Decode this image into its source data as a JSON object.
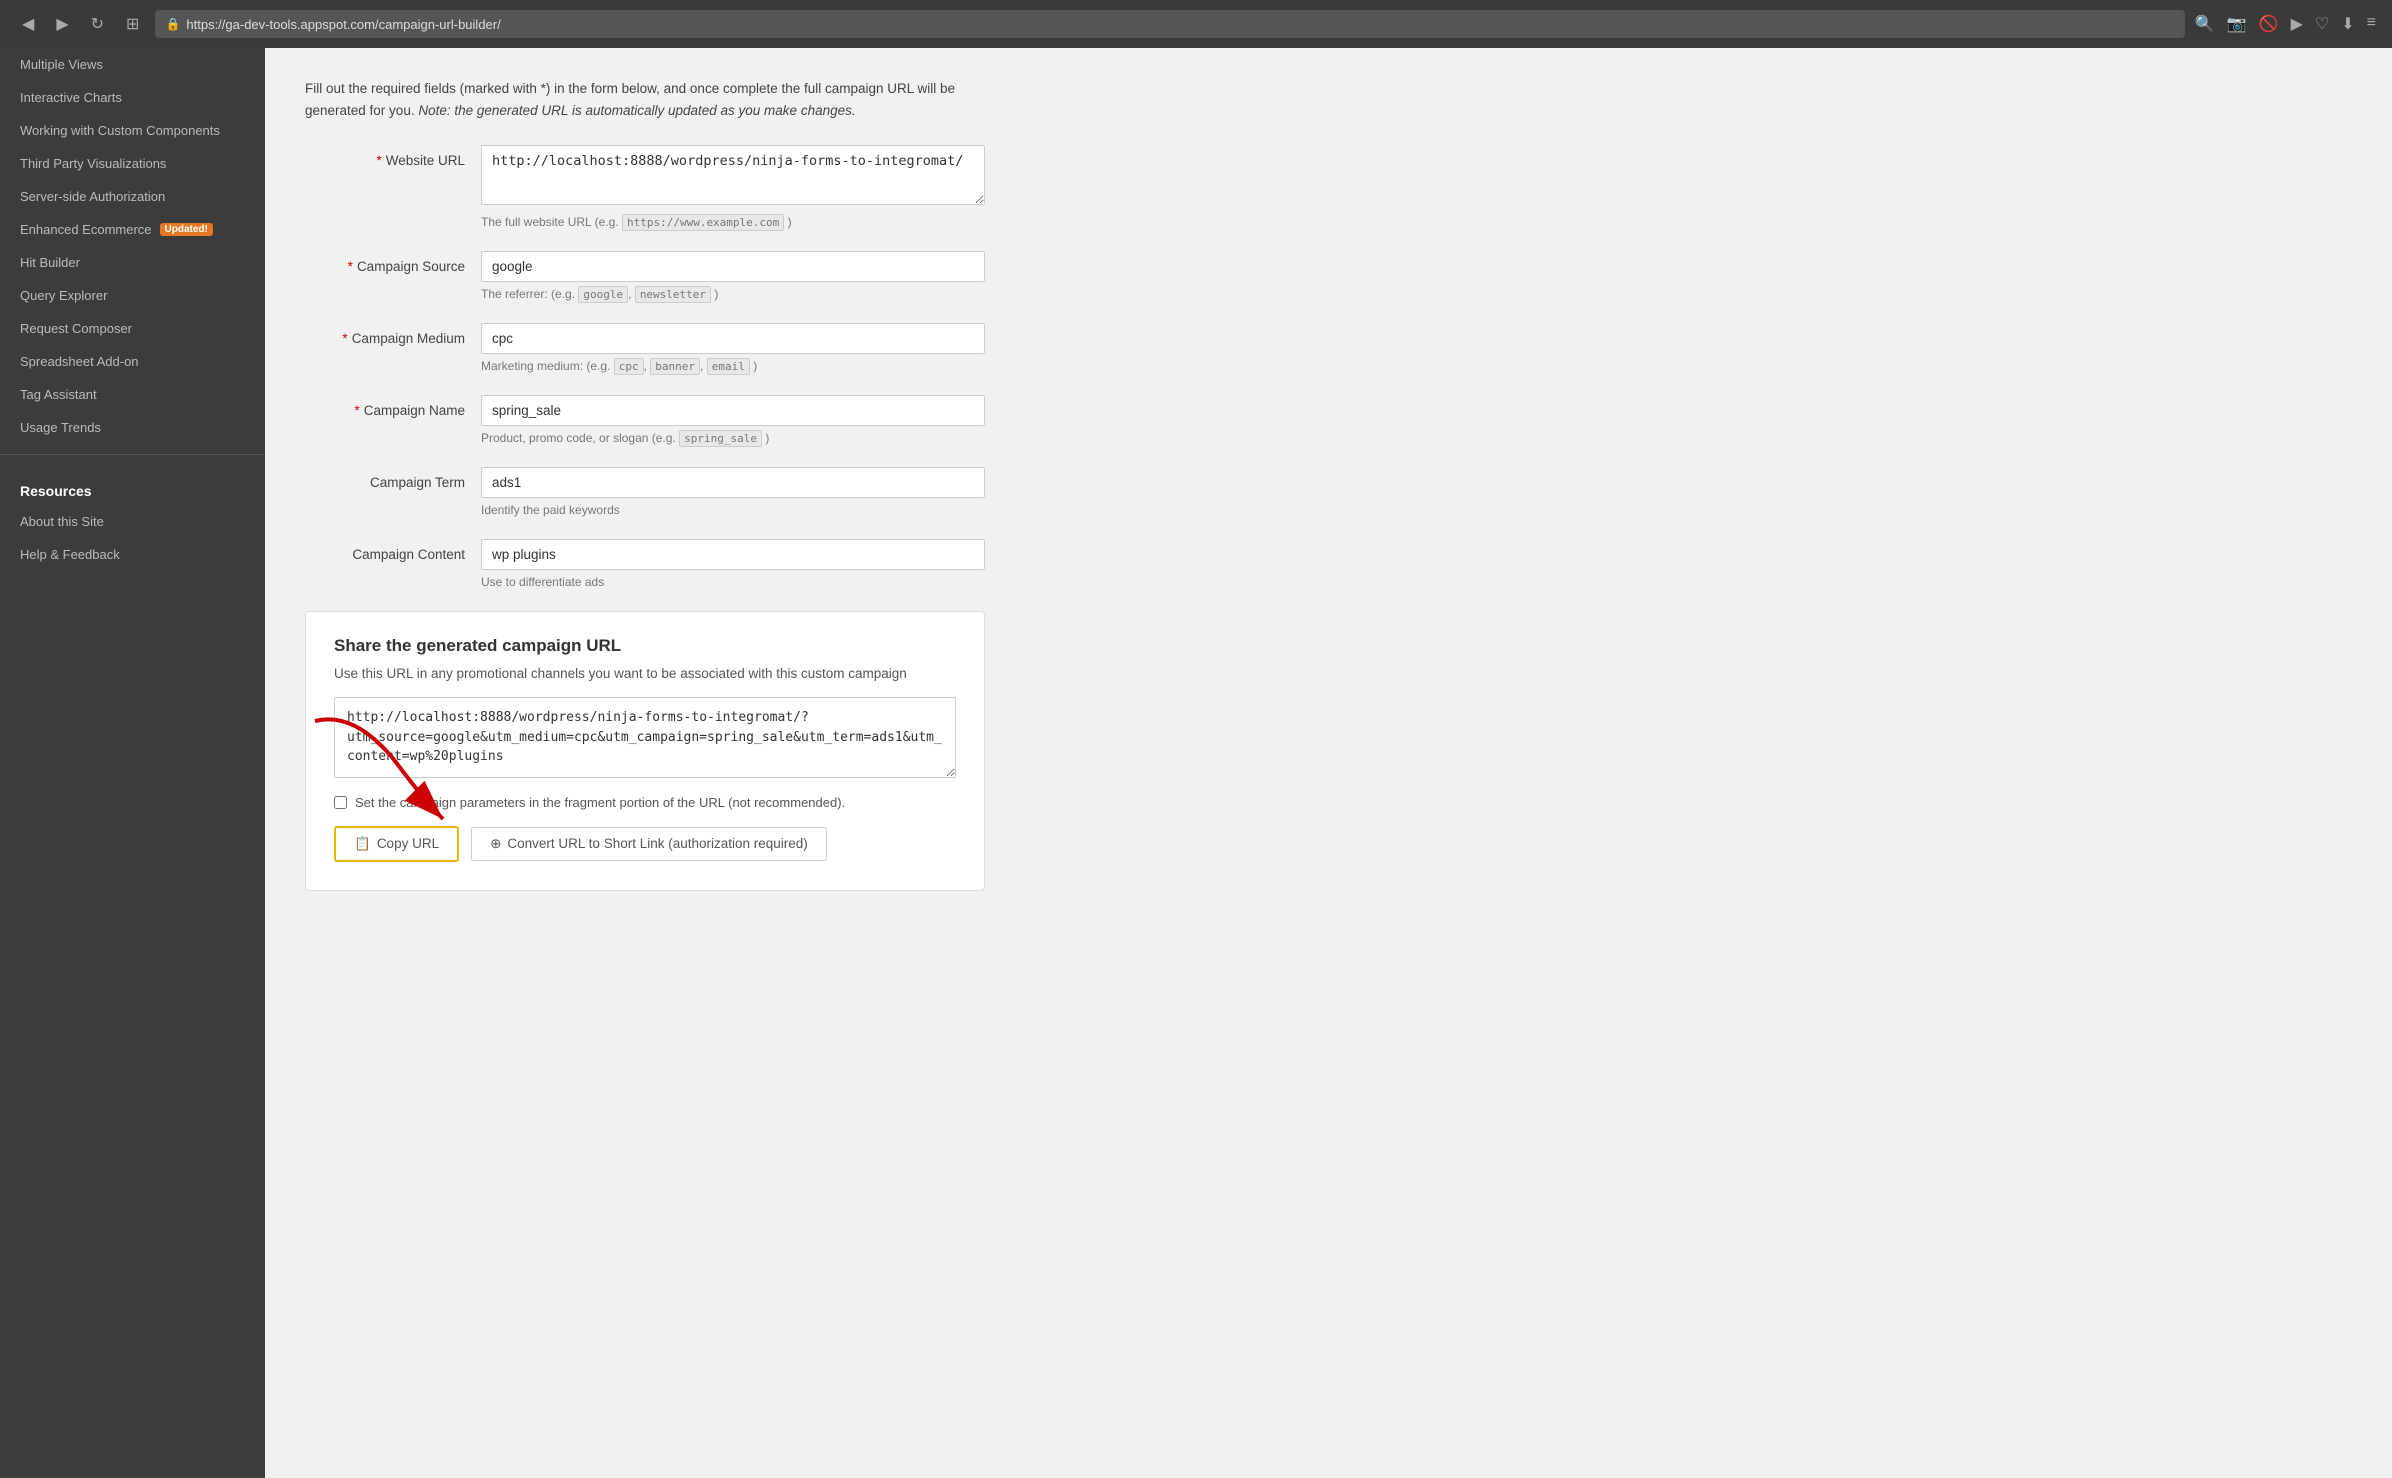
{
  "browser": {
    "url": "https://ga-dev-tools.appspot.com/campaign-url-builder/",
    "back_btn": "◀",
    "forward_btn": "▶",
    "refresh_btn": "↻",
    "grid_btn": "⊞"
  },
  "sidebar": {
    "items_top": [
      {
        "label": "Multiple Views"
      },
      {
        "label": "Interactive Charts"
      },
      {
        "label": "Working with Custom Components"
      },
      {
        "label": "Third Party Visualizations"
      },
      {
        "label": "Server-side Authorization"
      }
    ],
    "enhanced_ecommerce": "Enhanced Ecommerce",
    "badge": "Updated!",
    "items_mid": [
      {
        "label": "Hit Builder"
      },
      {
        "label": "Query Explorer"
      },
      {
        "label": "Request Composer"
      },
      {
        "label": "Spreadsheet Add-on"
      },
      {
        "label": "Tag Assistant"
      },
      {
        "label": "Usage Trends"
      }
    ],
    "resources_header": "Resources",
    "items_resources": [
      {
        "label": "About this Site"
      },
      {
        "label": "Help & Feedback"
      }
    ]
  },
  "intro": {
    "text1": "Fill out the required fields (marked with *) in the form below, and once complete the full campaign URL will be generated for you.",
    "text2": "Note: the generated URL is automatically updated as you make changes."
  },
  "form": {
    "website_url": {
      "label": "Website URL",
      "required": true,
      "value": "http://localhost:8888/wordpress/ninja-forms-to-integromat/",
      "hint": "The full website URL (e.g.",
      "hint_code": "https://www.example.com",
      "hint_end": ")"
    },
    "campaign_source": {
      "label": "Campaign Source",
      "required": true,
      "value": "google",
      "hint": "The referrer: (e.g.",
      "hint_code1": "google",
      "hint_sep": ",",
      "hint_code2": "newsletter",
      "hint_end": ")"
    },
    "campaign_medium": {
      "label": "Campaign Medium",
      "required": true,
      "value": "cpc",
      "hint": "Marketing medium: (e.g.",
      "hint_code1": "cpc",
      "hint_sep": ",",
      "hint_code2": "banner",
      "hint_sep2": ",",
      "hint_code3": "email",
      "hint_end": ")"
    },
    "campaign_name": {
      "label": "Campaign Name",
      "required": true,
      "value": "spring_sale",
      "hint": "Product, promo code, or slogan (e.g.",
      "hint_code": "spring_sale",
      "hint_end": ")"
    },
    "campaign_term": {
      "label": "Campaign Term",
      "required": false,
      "value": "ads1",
      "hint": "Identify the paid keywords"
    },
    "campaign_content": {
      "label": "Campaign Content",
      "required": false,
      "value": "wp plugins",
      "hint": "Use to differentiate ads"
    }
  },
  "share": {
    "title": "Share the generated campaign URL",
    "desc": "Use this URL in any promotional channels you want to be associated with this custom campaign",
    "generated_url": "http://localhost:8888/wordpress/ninja-forms-to-integromat/?utm_source=google&utm_medium=cpc&utm_campaign=spring_sale&utm_term=ads1&utm_content=wp%20plugins",
    "fragment_label": "Set the campaign parameters in the fragment portion of the URL (not recommended).",
    "copy_btn": "Copy URL",
    "convert_btn": "Convert URL to Short Link (authorization required)"
  }
}
